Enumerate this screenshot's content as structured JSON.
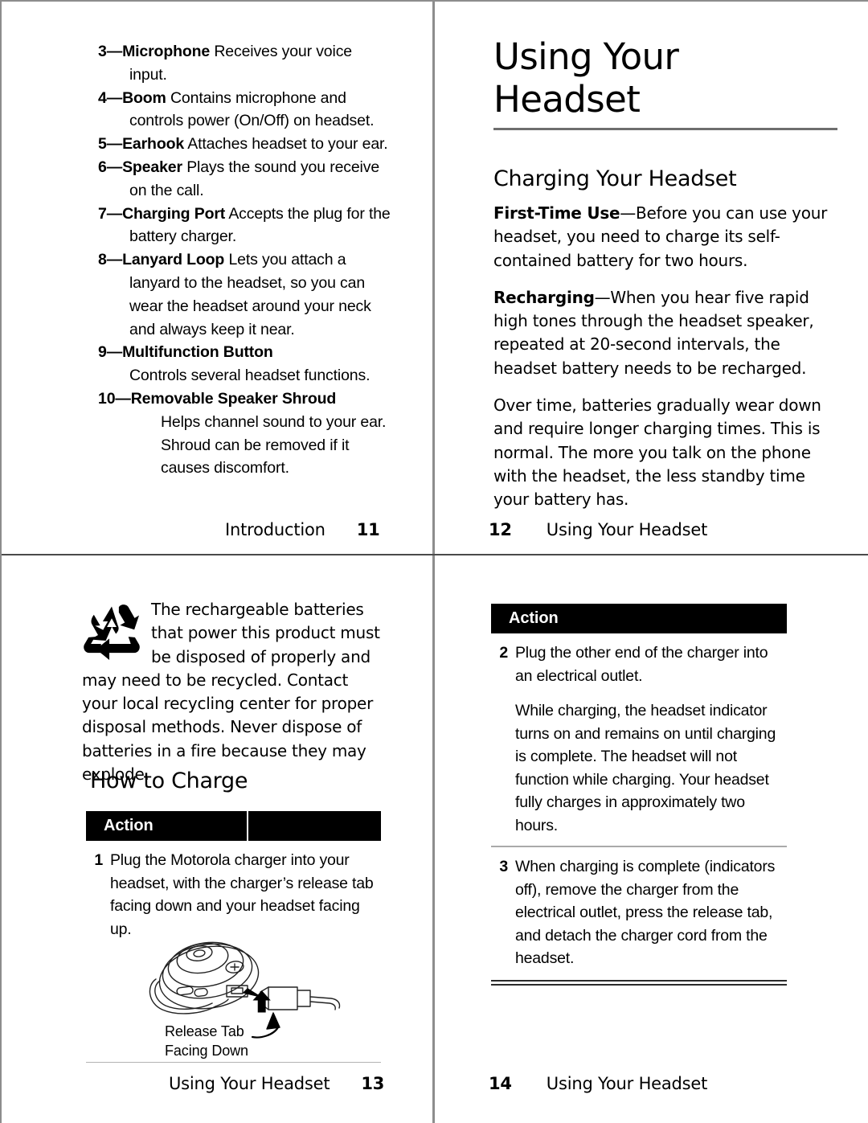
{
  "document": {
    "type": "printed-manual-spread",
    "pages": [
      {
        "page_number": "11",
        "footer_section": "Introduction",
        "footer_order": "section-then-number"
      },
      {
        "page_number": "12",
        "footer_section": "Using Your Headset",
        "footer_order": "number-then-section"
      },
      {
        "page_number": "13",
        "footer_section": "Using Your Headset",
        "footer_order": "section-then-number"
      },
      {
        "page_number": "14",
        "footer_section": "Using Your Headset",
        "footer_order": "number-then-section"
      }
    ]
  },
  "page11": {
    "callouts": [
      {
        "number": "3",
        "dash": "—",
        "term": "Microphone",
        "description": "Receives your voice input."
      },
      {
        "number": "4",
        "dash": "—",
        "term": "Boom",
        "description": "Contains microphone and controls power (On/Off) on headset."
      },
      {
        "number": "5",
        "dash": "—",
        "term": "Earhook",
        "description": "Attaches headset to your ear."
      },
      {
        "number": "6",
        "dash": "—",
        "term": "Speaker",
        "description": "Plays the sound you receive on the call."
      },
      {
        "number": "7",
        "dash": "—",
        "term": "Charging Port",
        "description": "Accepts the plug for the battery charger."
      },
      {
        "number": "8",
        "dash": "—",
        "term": "Lanyard Loop",
        "description": "Lets you attach a lanyard to the headset, so you can wear the headset around your neck and always keep it near."
      },
      {
        "number": "9",
        "dash": "—",
        "term": "Multifunction Button",
        "description": "Controls several headset functions."
      },
      {
        "number": "10",
        "dash": "—",
        "term": "Removable Speaker Shroud",
        "description": "Helps channel sound to your ear. Shroud can be removed if it causes discomfort."
      }
    ],
    "footer": {
      "section": "Introduction",
      "page": "11"
    }
  },
  "page12": {
    "title_line1": "Using Your",
    "title_line2": "Headset",
    "heading": "Charging Your Headset",
    "paragraphs": [
      {
        "lead": "First-Time Use",
        "dash": "—",
        "text": "Before you can use your headset, you need to charge its self-contained battery for two hours."
      },
      {
        "lead": "Recharging",
        "dash": "—",
        "text": "When you hear five rapid high tones through the headset speaker, repeated at 20-second intervals, the headset battery needs to be recharged."
      },
      {
        "lead": "",
        "dash": "",
        "text": "Over time, batteries gradually wear down and require longer charging times. This is normal. The more you talk on the phone with the headset, the less standby time your battery has."
      }
    ],
    "footer": {
      "section": "Using Your Headset",
      "page": "12"
    }
  },
  "page13": {
    "recycle_icon": "recycle-icon",
    "notice": "The rechargeable batteries that power this product must be disposed of properly and may need to be recycled. Contact your local recycling center for proper disposal methods. Never dispose of batteries in a fire because they may explode.",
    "heading": "How to Charge",
    "table": {
      "header": "Action",
      "rows": [
        {
          "number": "1",
          "paragraphs": [
            "Plug the Motorola charger into your headset, with the charger’s release tab facing down and your headset facing up."
          ]
        }
      ]
    },
    "figure": {
      "name": "headset-charger-illustration",
      "caption_line1": "Release Tab",
      "caption_line2": "Facing Down"
    },
    "footer": {
      "section": "Using Your Headset",
      "page": "13"
    }
  },
  "page14": {
    "table": {
      "header": "Action",
      "rows": [
        {
          "number": "2",
          "paragraphs": [
            "Plug the other end of the charger into an electrical outlet.",
            "While charging, the headset indicator turns on and remains on until charging is complete. The headset will not function while charging. Your headset fully charges in approximately two hours."
          ]
        },
        {
          "number": "3",
          "paragraphs": [
            "When charging is complete (indicators off), remove the charger from the electrical outlet, press the release tab, and detach the charger cord from the headset."
          ]
        }
      ]
    },
    "footer": {
      "section": "Using Your Headset",
      "page": "14"
    }
  },
  "colors": {
    "ink": "#000000",
    "page_background": "#ffffff",
    "rule_gray": "#8d8d8d",
    "table_header_background": "#000000",
    "table_header_text": "#ffffff",
    "row_divider": "#aaaaaa"
  }
}
